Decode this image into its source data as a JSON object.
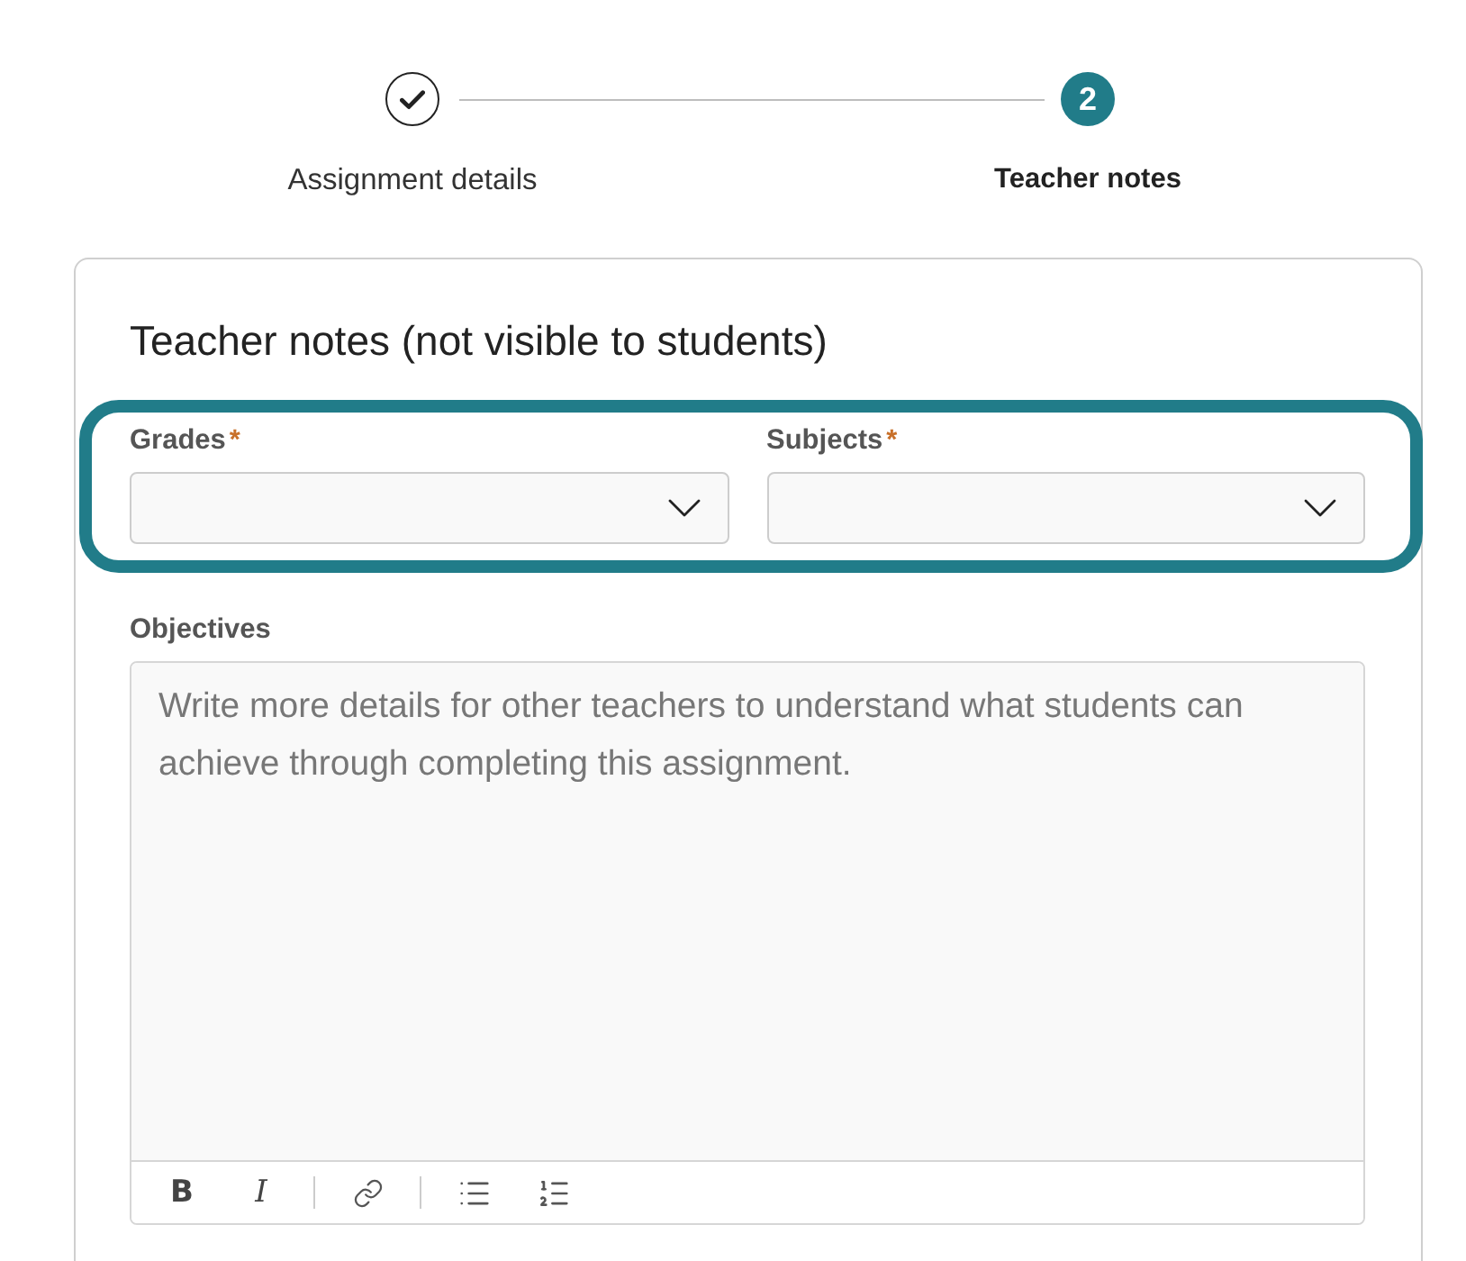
{
  "stepper": {
    "steps": [
      {
        "label": "Assignment details",
        "completed": true,
        "selected": false
      },
      {
        "label": "Teacher notes",
        "number": "2",
        "completed": false,
        "selected": true
      }
    ]
  },
  "card": {
    "title": "Teacher notes (not visible to students)",
    "required_fields": {
      "highlighted": true,
      "fields": [
        {
          "label": "Grades",
          "required_mark": "*"
        },
        {
          "label": "Subjects",
          "required_mark": "*"
        }
      ]
    },
    "objectives": {
      "label": "Objectives",
      "placeholder": "Write more details for other teachers to understand what students can achieve through completing this assignment.",
      "toolbar": [
        {
          "kind": "bold",
          "label": "B"
        },
        {
          "kind": "italic",
          "label": "I"
        },
        {
          "kind": "divider"
        },
        {
          "kind": "link"
        },
        {
          "kind": "divider"
        },
        {
          "kind": "bulleted_list"
        },
        {
          "kind": "numbered_list"
        }
      ]
    }
  }
}
